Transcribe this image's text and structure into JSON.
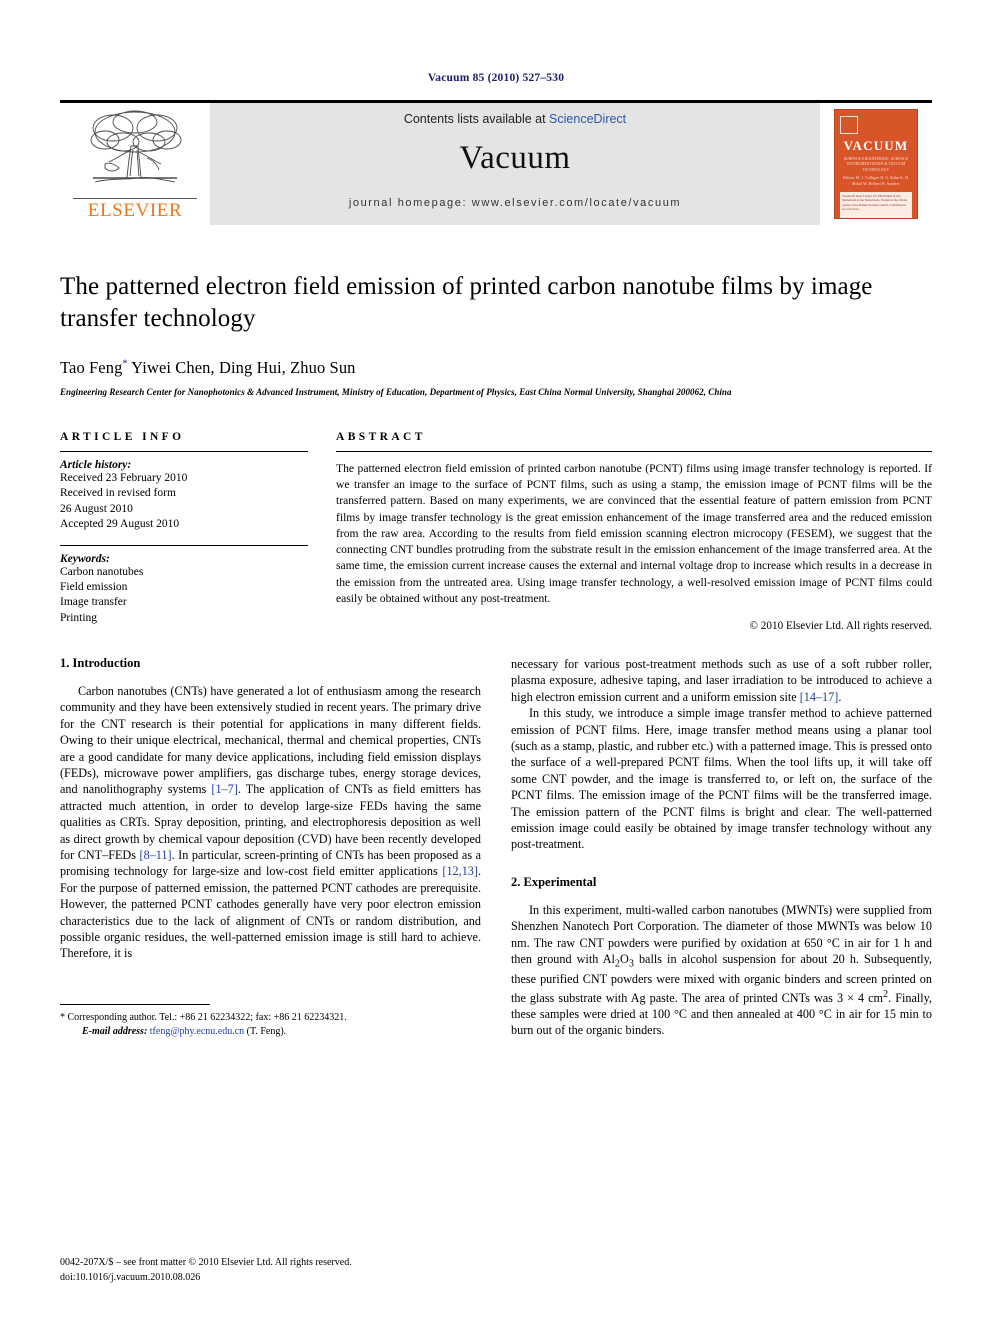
{
  "running_head": "Vacuum 85 (2010) 527–530",
  "masthead": {
    "contents_prefix": "Contents lists available at ",
    "sciencedirect": "ScienceDirect",
    "journal_name": "Vacuum",
    "homepage": "journal homepage: www.elsevier.com/locate/vacuum",
    "publisher_wordmark": "ELSEVIER",
    "cover": {
      "title": "VACUUM",
      "subtitle": "SURFACE ENGINEERING, SURFACE INSTRUMENTATION\n& VACUUM TECHNOLOGY",
      "editors": "Editors\nM. J. Colligon   H. G. Kuhn   K. H. Mittal\nW. Holbert   B. Sanders",
      "body_note": "Volume 85 Issue 5 Pages 527-660 Printed in The Netherlands in the Netherlands.\nVacuum is the official journal of the British Vacuum Council. Contributions are welcomed.",
      "footer": "Available online at\nScienceDirect"
    }
  },
  "article": {
    "title": "The patterned electron field emission of printed carbon nanotube films by image transfer technology",
    "authors": "Tao Feng, Yiwei Chen, Ding Hui, Zhuo Sun",
    "corresponding_marker": "*",
    "affiliation": "Engineering Research Center for Nanophotonics & Advanced Instrument, Ministry of Education, Department of Physics, East China Normal University, Shanghai 200062, China"
  },
  "article_info": {
    "label": "ARTICLE INFO",
    "history_title": "Article history:",
    "history": [
      "Received 23 February 2010",
      "Received in revised form",
      "26 August 2010",
      "Accepted 29 August 2010"
    ],
    "keywords_title": "Keywords:",
    "keywords": [
      "Carbon nanotubes",
      "Field emission",
      "Image transfer",
      "Printing"
    ]
  },
  "abstract": {
    "label": "ABSTRACT",
    "text": "The patterned electron field emission of printed carbon nanotube (PCNT) films using image transfer technology is reported. If we transfer an image to the surface of PCNT films, such as using a stamp, the emission image of PCNT films will be the transferred pattern. Based on many experiments, we are convinced that the essential feature of pattern emission from PCNT films by image transfer technology is the great emission enhancement of the image transferred area and the reduced emission from the raw area. According to the results from field emission scanning electron microcopy (FESEM), we suggest that the connecting CNT bundles protruding from the substrate result in the emission enhancement of the image transferred area. At the same time, the emission current increase causes the external and internal voltage drop to increase which results in a decrease in the emission from the untreated area. Using image transfer technology, a well-resolved emission image of PCNT films could easily be obtained without any post-treatment.",
    "copyright": "© 2010 Elsevier Ltd. All rights reserved."
  },
  "sections": {
    "introduction_head": "1.  Introduction",
    "intro_p1_a": "Carbon nanotubes (CNTs) have generated a lot of enthusiasm among the research community and they have been extensively studied in recent years. The primary drive for the CNT research is their potential for applications in many different fields. Owing to their unique electrical, mechanical, thermal and chemical properties, CNTs are a good candidate for many device applications, including field emission displays (FEDs), microwave power amplifiers, gas discharge tubes, energy storage devices, and nanolithography systems ",
    "ref_1_7": "[1–7]",
    "intro_p1_b": ". The application of CNTs as field emitters has attracted much attention, in order to develop large-size FEDs having the same qualities as CRTs. Spray deposition, printing, and electrophoresis deposition as well as direct growth by chemical vapour deposition (CVD) have been recently developed for CNT–FEDs ",
    "ref_8_11": "[8–11]",
    "intro_p1_c": ". In particular, screen-printing of CNTs has been proposed as a promising technology for large-size and low-cost field emitter applications ",
    "ref_12_13": "[12,13]",
    "intro_p1_d": ". For the purpose of patterned emission, the patterned PCNT cathodes are prerequisite. However, the patterned PCNT cathodes generally have very poor electron emission characteristics due to the lack of alignment of CNTs or random distribution, and possible organic residues, the well-patterned emission image is still hard to achieve. Therefore, it is",
    "intro_p1_e": "necessary for various post-treatment methods such as use of a soft rubber roller, plasma exposure, adhesive taping, and laser irradiation to be introduced to achieve a high electron emission current and a uniform emission site ",
    "ref_14_17": "[14–17]",
    "intro_p1_f": ".",
    "intro_p2": "In this study, we introduce a simple image transfer method to achieve patterned emission of PCNT films. Here, image transfer method means using a planar tool (such as a stamp, plastic, and rubber etc.) with a patterned image. This is pressed onto the surface of a well-prepared PCNT films. When the tool lifts up, it will take off some CNT powder, and the image is transferred to, or left on, the surface of the PCNT films. The emission image of the PCNT films will be the transferred image. The emission pattern of the PCNT films is bright and clear. The well-patterned emission image could easily be obtained by image transfer technology without any post-treatment.",
    "experimental_head": "2.  Experimental",
    "exp_p1_a": "In this experiment, multi-walled carbon nanotubes (MWNTs) were supplied from Shenzhen Nanotech Port Corporation. The diameter of those MWNTs was below 10 nm. The raw CNT powders were purified by oxidation at 650 °C in air for 1 h and then ground with Al",
    "exp_sub_2": "2",
    "exp_p1_b": "O",
    "exp_sub_3": "3",
    "exp_p1_c": " balls in alcohol suspension for about 20 h. Subsequently, these purified CNT powders were mixed with organic binders and screen printed on the glass substrate with Ag paste. The area of printed CNTs was 3 × 4 cm",
    "exp_sup_2": "2",
    "exp_p1_d": ". Finally, these samples were dried at 100 °C and then annealed at 400 °C in air for 15 min to burn out of the organic binders."
  },
  "footnote": {
    "marker": "*",
    "corresponding": "Corresponding author. Tel.: +86 21 62234322; fax: +86 21 62234321.",
    "email_label": "E-mail address:",
    "email": "tfeng@phy.ecnu.edu.cn",
    "email_suffix": "(T. Feng)."
  },
  "page_footer": {
    "issn_line": "0042-207X/$ – see front matter © 2010 Elsevier Ltd. All rights reserved.",
    "doi_line": "doi:10.1016/j.vacuum.2010.08.026"
  },
  "colors": {
    "elsevier_orange": "#E87722",
    "link_blue": "#2b59a8",
    "ref_blue": "#1f3d9e",
    "header_navy": "#1a1a6e",
    "masthead_grey": "#e4e4e4",
    "cover_orange": "#d8552a"
  }
}
